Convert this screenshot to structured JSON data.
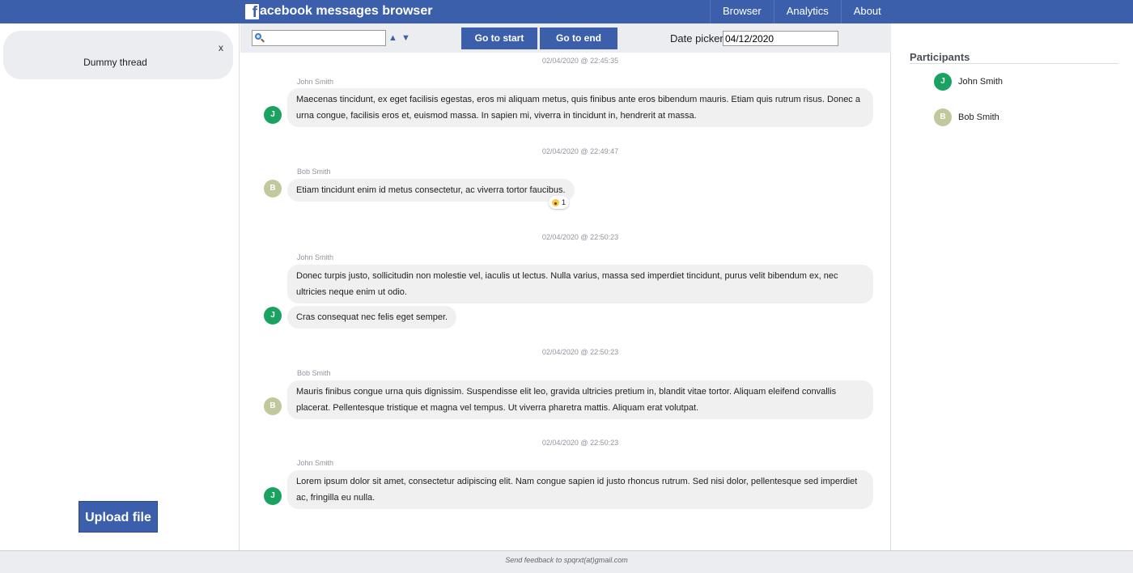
{
  "header": {
    "logo_letter": "f",
    "brand": "acebook messages browser",
    "nav": [
      "Browser",
      "Analytics",
      "About"
    ]
  },
  "left": {
    "thread": {
      "name": "Dummy thread",
      "close": "x"
    },
    "upload_label": "Upload file"
  },
  "toolbar": {
    "search_placeholder": "",
    "up_arrow": "▲",
    "down_arrow": "▼",
    "go_start": "Go to start",
    "go_end": "Go to end",
    "date_label": "Date picker:",
    "date_value": "04/12/2020"
  },
  "messages": [
    {
      "timestamp": "02/04/2020 @ 22:45:35",
      "sender": "John Smith",
      "initial": "J",
      "bubbles": [
        "Maecenas tincidunt, ex eget facilisis egestas, eros mi aliquam metus, quis finibus ante eros bibendum mauris. Etiam quis rutrum risus. Donec a urna congue, facilisis eros et, euismod massa. In sapien mi, viverra in tincidunt in, hendrerit at massa."
      ]
    },
    {
      "timestamp": "02/04/2020 @ 22:49:47",
      "sender": "Bob Smith",
      "initial": "B",
      "bubbles": [
        "Etiam tincidunt enim id metus consectetur, ac viverra tortor faucibus."
      ],
      "reaction": {
        "icon": "wow-emoji-icon",
        "count": "1"
      }
    },
    {
      "timestamp": "02/04/2020 @ 22:50:23",
      "sender": "John Smith",
      "initial": "J",
      "bubbles": [
        "Donec turpis justo, sollicitudin non molestie vel, iaculis ut lectus. Nulla varius, massa sed imperdiet tincidunt, purus velit bibendum ex, nec ultricies neque enim ut odio.",
        "Cras consequat nec felis eget semper."
      ]
    },
    {
      "timestamp": "02/04/2020 @ 22:50:23",
      "sender": "Bob Smith",
      "initial": "B",
      "bubbles": [
        "Mauris finibus congue urna quis dignissim. Suspendisse elit leo, gravida ultricies pretium in, blandit vitae tortor. Aliquam eleifend convallis placerat. Pellentesque tristique et magna vel tempus. Ut viverra pharetra mattis. Aliquam erat volutpat."
      ]
    },
    {
      "timestamp": "02/04/2020 @ 22:50:23",
      "sender": "John Smith",
      "initial": "J",
      "bubbles": [
        "Lorem ipsum dolor sit amet, consectetur adipiscing elit. Nam congue sapien id justo rhoncus rutrum. Sed nisi dolor, pellentesque sed imperdiet ac, fringilla eu nulla."
      ]
    }
  ],
  "right": {
    "title": "Participants",
    "participants": [
      {
        "initial": "J",
        "name": "John Smith"
      },
      {
        "initial": "B",
        "name": "Bob Smith"
      }
    ]
  },
  "footer": {
    "text": "Send feedback to spqrxt(at)gmail.com"
  },
  "colors": {
    "brand": "#3b5fab",
    "john_avatar": "#1aa260",
    "bob_avatar": "#c0c89c",
    "bubble": "#f1f0f0"
  }
}
